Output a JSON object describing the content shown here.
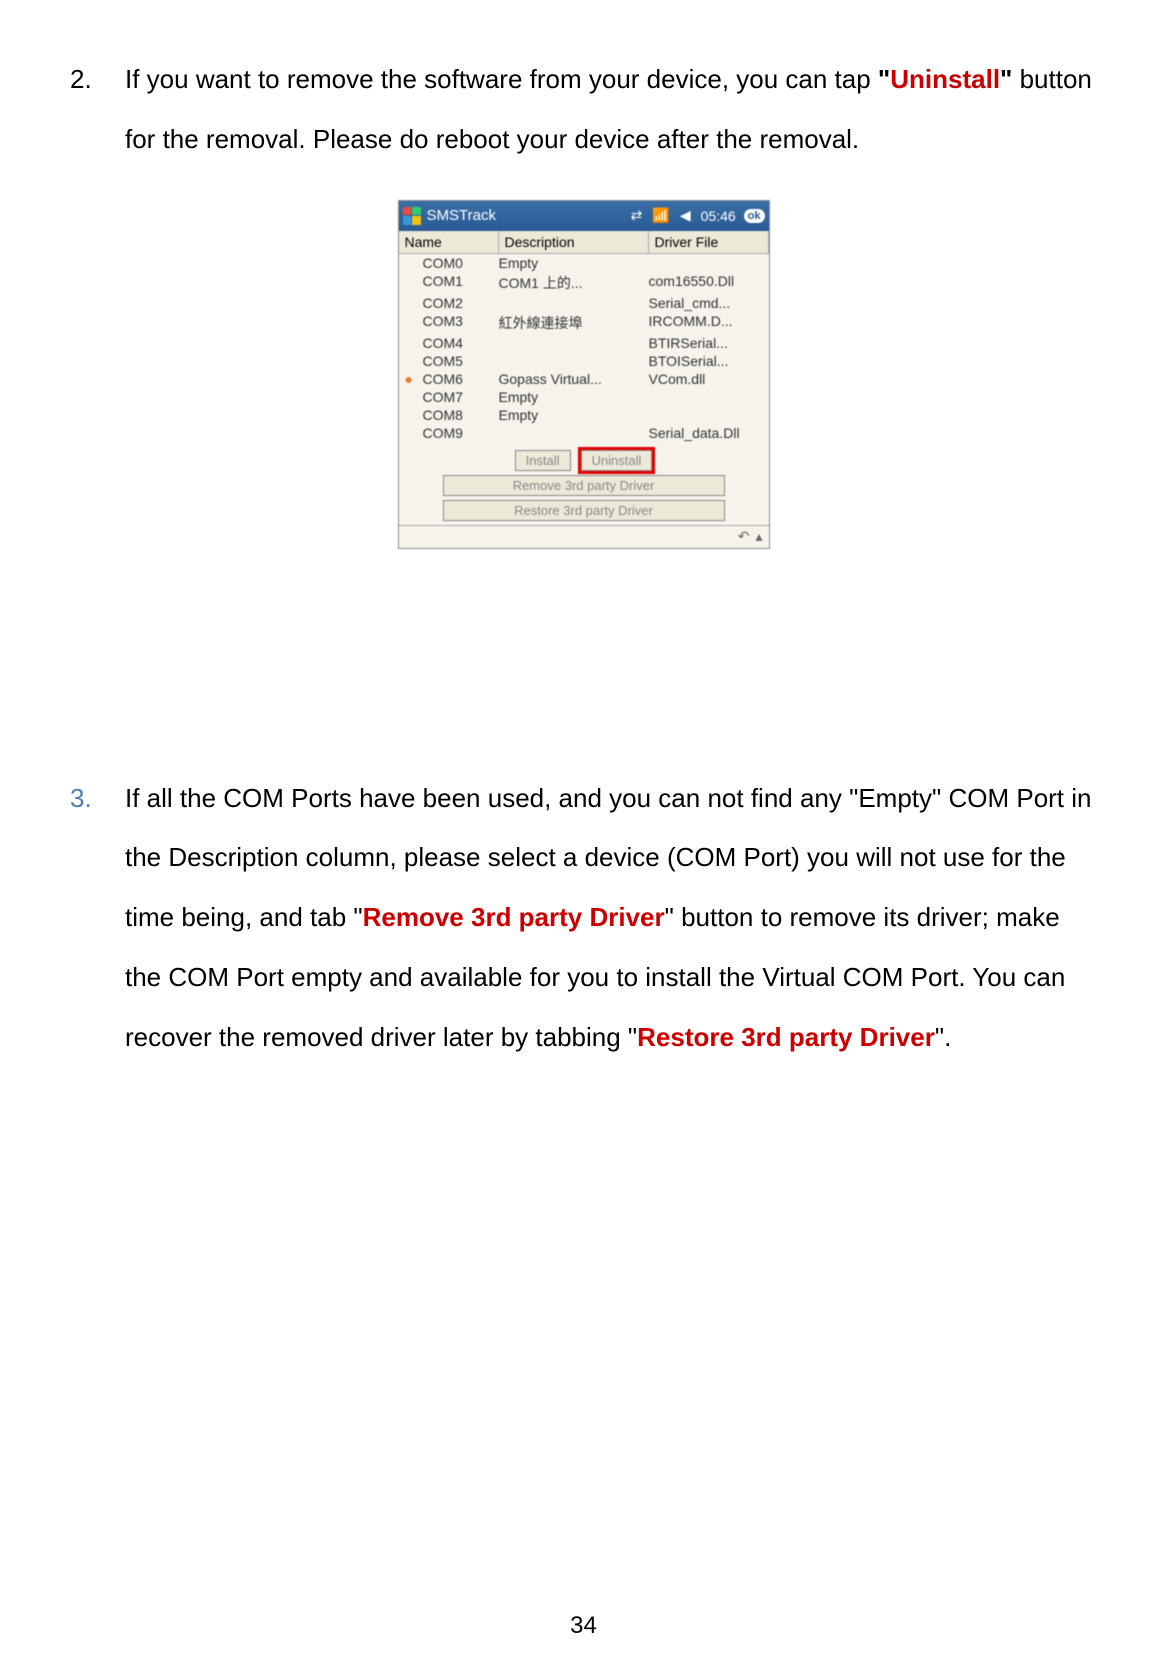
{
  "item2": {
    "number": "2.",
    "pre": "If you want to remove the software from your device, you can tap ",
    "quote_open": "\"",
    "highlight": "Uninstall",
    "quote_close": "\"",
    "post": " button for the removal.    Please do reboot your device after the removal."
  },
  "screenshot": {
    "title": "SMSTrack",
    "time": "05:46",
    "ok": "ok",
    "headers": {
      "name": "Name",
      "desc": "Description",
      "driver": "Driver File"
    },
    "rows": [
      {
        "name": "COM0",
        "desc": "Empty",
        "driver": ""
      },
      {
        "name": "COM1",
        "desc": "COM1 上的...",
        "driver": "com16550.Dll"
      },
      {
        "name": "COM2",
        "desc": "",
        "driver": "Serial_cmd..."
      },
      {
        "name": "COM3",
        "desc": "紅外線連接埠",
        "driver": "IRCOMM.D..."
      },
      {
        "name": "COM4",
        "desc": "",
        "driver": "BTIRSerial..."
      },
      {
        "name": "COM5",
        "desc": "",
        "driver": "BTOISerial..."
      },
      {
        "name": "COM6",
        "desc": "Gopass Virtual...",
        "driver": "VCom.dll",
        "icon": true
      },
      {
        "name": "COM7",
        "desc": "Empty",
        "driver": ""
      },
      {
        "name": "COM8",
        "desc": "Empty",
        "driver": ""
      },
      {
        "name": "COM9",
        "desc": "",
        "driver": "Serial_data.Dll"
      }
    ],
    "buttons": {
      "install": "Install",
      "uninstall": "Uninstall",
      "remove": "Remove 3rd party Driver",
      "restore": "Restore 3rd party Driver"
    }
  },
  "item3": {
    "number": "3.",
    "p1a": "If all the COM Ports have been used, and you can not find any \"Empty\" COM Port in the Description column, please select a device (COM Port) you will not use for the time being, and tab \"",
    "hl1": "Remove 3rd party Driver",
    "p1b": "\" button to remove its driver; make the COM Port empty and available for you to install the Virtual COM Port. You can recover the removed driver later by tabbing \"",
    "hl2": "Restore 3rd party Driver",
    "p1c": "\"."
  },
  "page_number": "34"
}
